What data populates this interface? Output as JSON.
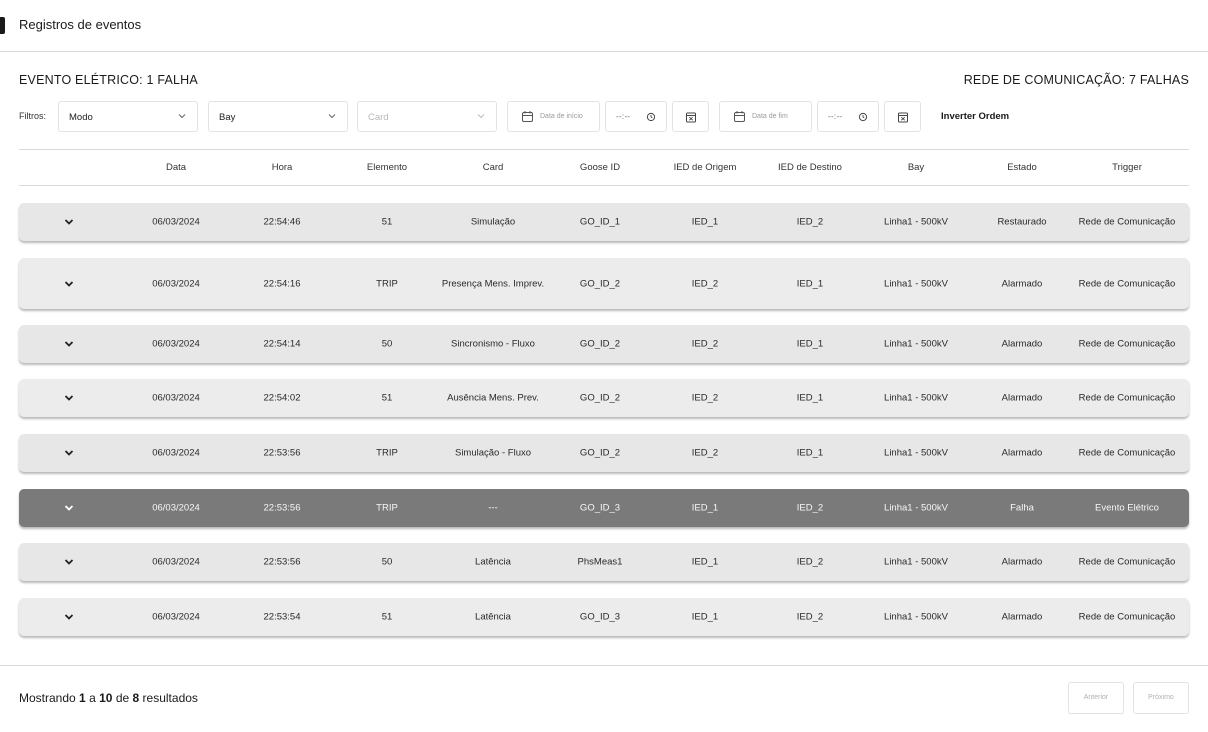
{
  "page": {
    "title": "Registros de eventos"
  },
  "summary": {
    "left": "EVENTO ELÉTRICO: 1 FALHA",
    "right": "REDE DE COMUNICAÇÃO: 7 FALHAS"
  },
  "filters": {
    "label": "Filtros:",
    "modo": "Modo",
    "bay": "Bay",
    "card": "Card",
    "start_date_placeholder": "Data de início",
    "start_time": "--:--",
    "end_date_placeholder": "Data de fim",
    "end_time": "--:--",
    "invert_label": "Inverter Ordem"
  },
  "table": {
    "headers": [
      "Data",
      "Hora",
      "Elemento",
      "Card",
      "Goose ID",
      "IED de Origem",
      "IED de Destino",
      "Bay",
      "Estado",
      "Trigger"
    ],
    "rows": [
      {
        "data": "06/03/2024",
        "hora": "22:54:46",
        "elemento": "51",
        "card": "Simulação",
        "goose": "GO_ID_1",
        "origem": "IED_1",
        "destino": "IED_2",
        "bay": "Linha1 - 500kV",
        "estado": "Restaurado",
        "trigger": "Rede de Comunicação"
      },
      {
        "data": "06/03/2024",
        "hora": "22:54:16",
        "elemento": "TRIP",
        "card": "Presença Mens. Imprev.",
        "goose": "GO_ID_2",
        "origem": "IED_2",
        "destino": "IED_1",
        "bay": "Linha1 - 500kV",
        "estado": "Alarmado",
        "trigger": "Rede de Comunicação"
      },
      {
        "data": "06/03/2024",
        "hora": "22:54:14",
        "elemento": "50",
        "card": "Sincronismo - Fluxo",
        "goose": "GO_ID_2",
        "origem": "IED_2",
        "destino": "IED_1",
        "bay": "Linha1 - 500kV",
        "estado": "Alarmado",
        "trigger": "Rede de Comunicação"
      },
      {
        "data": "06/03/2024",
        "hora": "22:54:02",
        "elemento": "51",
        "card": "Ausência Mens. Prev.",
        "goose": "GO_ID_2",
        "origem": "IED_2",
        "destino": "IED_1",
        "bay": "Linha1 - 500kV",
        "estado": "Alarmado",
        "trigger": "Rede de Comunicação"
      },
      {
        "data": "06/03/2024",
        "hora": "22:53:56",
        "elemento": "TRIP",
        "card": "Simulação - Fluxo",
        "goose": "GO_ID_2",
        "origem": "IED_2",
        "destino": "IED_1",
        "bay": "Linha1 - 500kV",
        "estado": "Alarmado",
        "trigger": "Rede de Comunicação"
      },
      {
        "data": "06/03/2024",
        "hora": "22:53:56",
        "elemento": "TRIP",
        "card": "---",
        "goose": "GO_ID_3",
        "origem": "IED_1",
        "destino": "IED_2",
        "bay": "Linha1 - 500kV",
        "estado": "Falha",
        "trigger": "Evento Elétrico"
      },
      {
        "data": "06/03/2024",
        "hora": "22:53:56",
        "elemento": "50",
        "card": "Latência",
        "goose": "PhsMeas1",
        "origem": "IED_1",
        "destino": "IED_2",
        "bay": "Linha1 - 500kV",
        "estado": "Alarmado",
        "trigger": "Rede de Comunicação"
      },
      {
        "data": "06/03/2024",
        "hora": "22:53:54",
        "elemento": "51",
        "card": "Latência",
        "goose": "GO_ID_3",
        "origem": "IED_1",
        "destino": "IED_2",
        "bay": "Linha1 - 500kV",
        "estado": "Alarmado",
        "trigger": "Rede de Comunicação"
      }
    ]
  },
  "footer": {
    "prefix": "Mostrando",
    "from": "1",
    "sep1": "a",
    "to": "10",
    "sep2": "de",
    "total": "8",
    "suffix": "resultados",
    "prev_label": "Anterior",
    "next_label": "Próximo"
  },
  "colors": {
    "row_bg": "#e7e7e7",
    "row_falha_bg": "#7a7a7a",
    "border": "#d9d9d9"
  }
}
